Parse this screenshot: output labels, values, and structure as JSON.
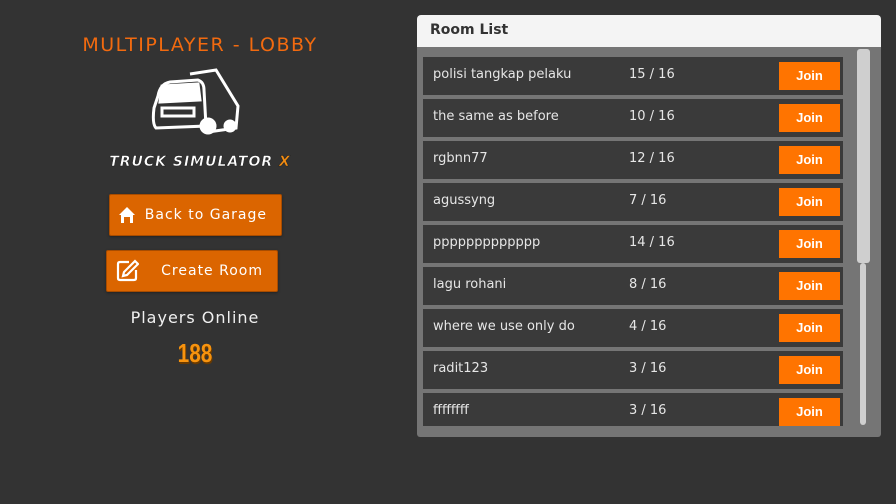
{
  "lobby": {
    "title": "MULTIPLAYER - LOBBY",
    "brand_text": "TRUCK SIMULATOR",
    "brand_suffix": "X",
    "back_button": "Back to Garage",
    "back_icon": "home-icon",
    "create_button": "Create Room",
    "create_icon": "edit-icon",
    "players_label": "Players Online",
    "players_count": "188"
  },
  "room_list": {
    "title": "Room List",
    "join_label": "Join",
    "rooms": [
      {
        "name": "polisi tangkap pelaku",
        "players": "15 / 16"
      },
      {
        "name": "the same as before",
        "players": "10 / 16"
      },
      {
        "name": "rgbnn77",
        "players": "12 / 16"
      },
      {
        "name": "agussyng",
        "players": "7 / 16"
      },
      {
        "name": "ppppppppppppp",
        "players": "14 / 16"
      },
      {
        "name": "lagu rohani",
        "players": "8 / 16"
      },
      {
        "name": "where we use only do",
        "players": "4 / 16"
      },
      {
        "name": "radit123",
        "players": "3 / 16"
      },
      {
        "name": "ffffffff",
        "players": "3 / 16"
      }
    ]
  },
  "colors": {
    "accent": "#db6500",
    "join": "#ff7400",
    "background": "#333333"
  }
}
